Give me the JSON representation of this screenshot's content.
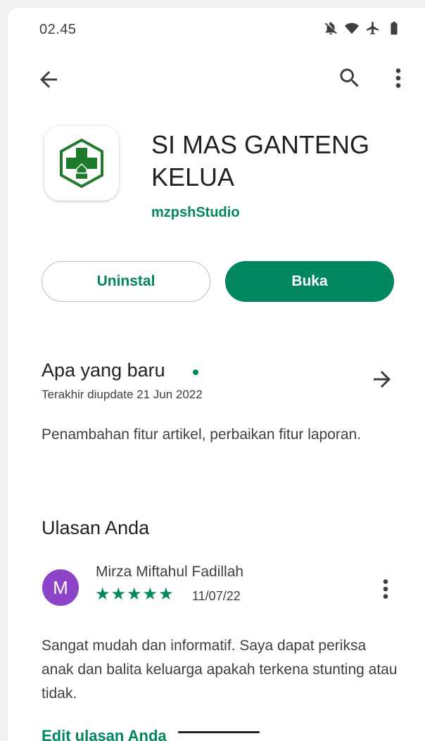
{
  "status_bar": {
    "time": "02.45"
  },
  "app": {
    "title": "SI MAS GANTENG KELUA",
    "developer": "mzpshStudio",
    "accent_color": "#01875f"
  },
  "actions": {
    "uninstall_label": "Uninstal",
    "open_label": "Buka"
  },
  "whats_new": {
    "title": "Apa yang baru",
    "updated": "Terakhir diupdate 21 Jun 2022",
    "text": "Penambahan fitur artikel, perbaikan fitur laporan."
  },
  "your_review": {
    "title": "Ulasan Anda",
    "avatar_letter": "M",
    "avatar_color": "#8e44c9",
    "reviewer": "Mirza Miftahul Fadillah",
    "rating": 5,
    "date": "11/07/22",
    "text": "Sangat mudah dan informatif. Saya dapat periksa anak dan balita keluarga apakah terkena stunting atau tidak.",
    "edit_label": "Edit ulasan Anda"
  },
  "icons": {
    "status": [
      "notifications-off-icon",
      "wifi-icon",
      "airplane-icon",
      "battery-icon"
    ],
    "app_bar": [
      "back-arrow-icon",
      "search-icon",
      "more-vert-icon"
    ]
  }
}
